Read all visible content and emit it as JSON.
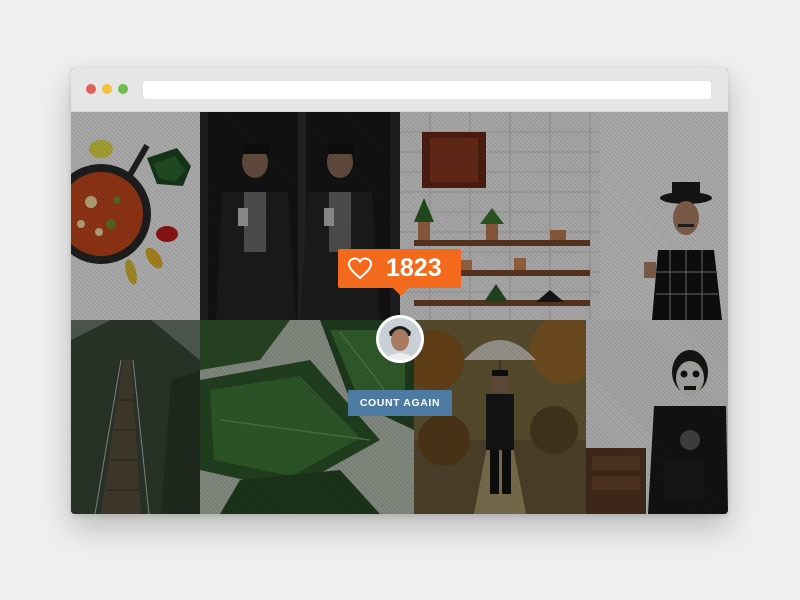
{
  "browser": {
    "dots": [
      {
        "name": "close",
        "color": "#e0605a"
      },
      {
        "name": "minimize",
        "color": "#f2c13d"
      },
      {
        "name": "maximize",
        "color": "#6cbf4a"
      }
    ],
    "address_value": ""
  },
  "overlay": {
    "like_count": "1823",
    "like_icon": "heart-outline-icon",
    "button_label": "COUNT AGAIN",
    "accent_color": "#f36a1c",
    "button_color": "#4d7aa3"
  },
  "photos": [
    "pizza-pan-and-peppers",
    "man-mirror-selfie",
    "kitchen-shelves-with-plants",
    "man-in-hat-with-mustache",
    "suspension-bridge-forest",
    "banana-leaves",
    "man-with-umbrella-autumn",
    "man-with-skull-face-paint"
  ]
}
